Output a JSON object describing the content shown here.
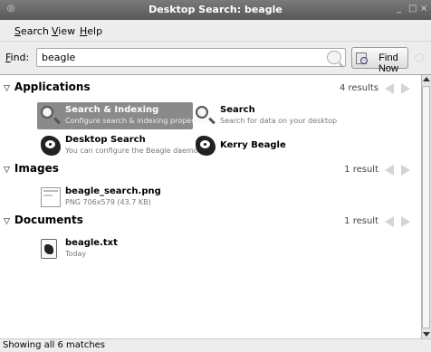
{
  "window": {
    "title": "Desktop Search: beagle",
    "controls": [
      "_",
      "□",
      "×"
    ]
  },
  "menu": {
    "items": [
      {
        "label": "Search",
        "mnemonic": "S",
        "rest": "earch"
      },
      {
        "label": "View",
        "mnemonic": "V",
        "rest": "iew"
      },
      {
        "label": "Help",
        "mnemonic": "H",
        "rest": "elp"
      }
    ]
  },
  "find": {
    "label_mnemonic": "F",
    "label_rest": "ind:",
    "value": "beagle",
    "button": "Find Now"
  },
  "categories": [
    {
      "name": "Applications",
      "count": "4 results",
      "hits": [
        {
          "title": "Search & Indexing",
          "subtitle": "Configure search & indexing properties",
          "icon": "magnifier-icon",
          "selected": true
        },
        {
          "title": "Search",
          "subtitle": "Search for data on your desktop",
          "icon": "magnifier-icon",
          "selected": false
        },
        {
          "title": "Desktop Search",
          "subtitle": "You can configure the Beagle daemo...",
          "icon": "beagle-dog-icon",
          "selected": false
        },
        {
          "title": "Kerry Beagle",
          "subtitle": "",
          "icon": "beagle-dog-icon",
          "selected": false
        }
      ]
    },
    {
      "name": "Images",
      "count": "1 result",
      "hits": [
        {
          "title": "beagle_search.png",
          "subtitle": "PNG 706x579 (43.7 KB)",
          "icon": "image-file-icon",
          "selected": false
        }
      ]
    },
    {
      "name": "Documents",
      "count": "1 result",
      "hits": [
        {
          "title": "beagle.txt",
          "subtitle": "Today",
          "icon": "text-file-icon",
          "selected": false
        }
      ]
    }
  ],
  "status": "Showing all 6 matches",
  "colors": {
    "titlebar": "#666666",
    "selection": "#8a8a8a",
    "chrome": "#ededed"
  }
}
